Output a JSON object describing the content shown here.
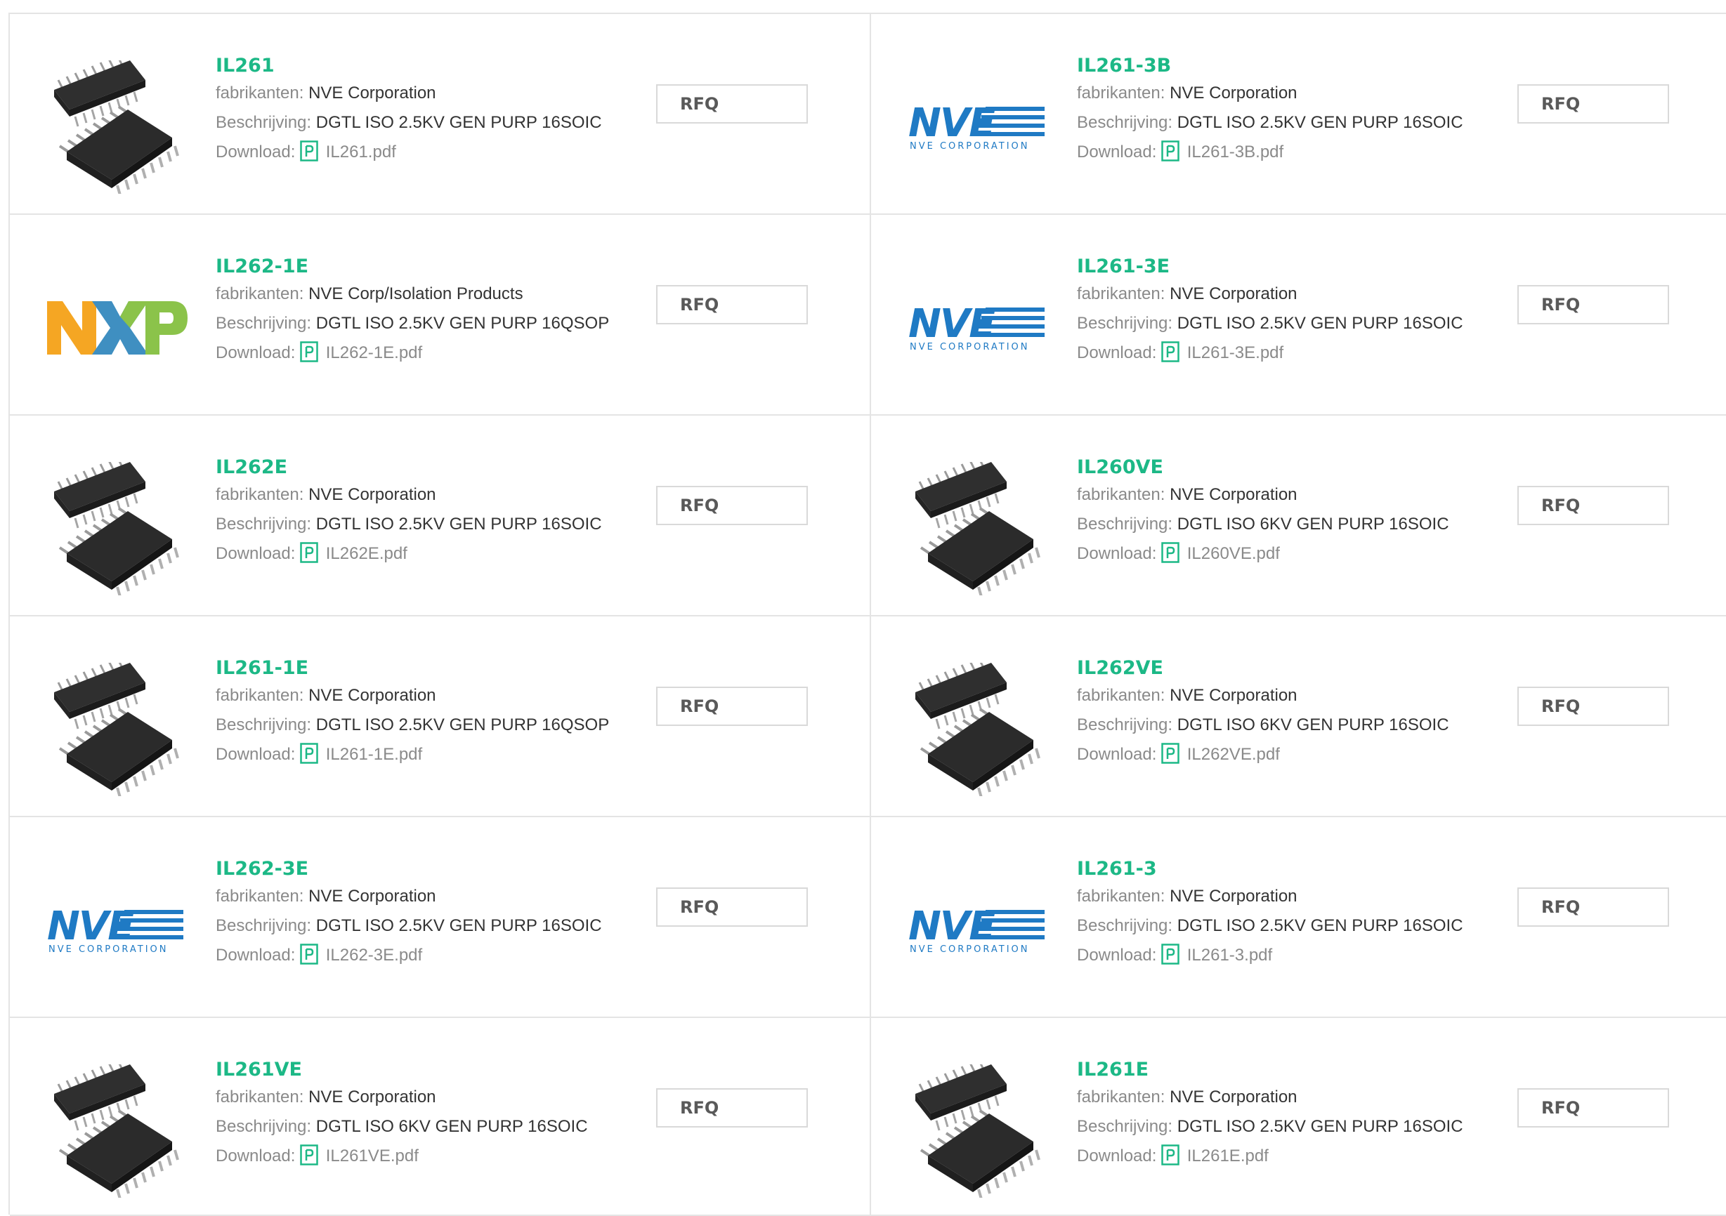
{
  "labels": {
    "manufacturer": "fabrikanten:",
    "description": "Beschrijving:",
    "download": "Download:",
    "rfq": "RFQ"
  },
  "colors": {
    "part_name": "#1cb886",
    "nve_blue": "#1f7ac4",
    "pdf_icon": "#1cb886"
  },
  "products": [
    {
      "name": "IL261",
      "manufacturer": "NVE Corporation",
      "description": "DGTL ISO 2.5KV GEN PURP 16SOIC",
      "file": "IL261.pdf",
      "image": "ic-chip"
    },
    {
      "name": "IL261-3B",
      "manufacturer": "NVE Corporation",
      "description": "DGTL ISO 2.5KV GEN PURP 16SOIC",
      "file": "IL261-3B.pdf",
      "image": "nve-logo",
      "logo_text": "NVE",
      "logo_sub": "NVE CORPORATION"
    },
    {
      "name": "IL262-1E",
      "manufacturer": "NVE Corp/Isolation Products",
      "description": "DGTL ISO 2.5KV GEN PURP 16QSOP",
      "file": "IL262-1E.pdf",
      "image": "nxp-logo"
    },
    {
      "name": "IL261-3E",
      "manufacturer": "NVE Corporation",
      "description": "DGTL ISO 2.5KV GEN PURP 16SOIC",
      "file": "IL261-3E.pdf",
      "image": "nve-logo",
      "logo_text": "NVE",
      "logo_sub": "NVE CORPORATION"
    },
    {
      "name": "IL262E",
      "manufacturer": "NVE Corporation",
      "description": "DGTL ISO 2.5KV GEN PURP 16SOIC",
      "file": "IL262E.pdf",
      "image": "ic-chip"
    },
    {
      "name": "IL260VE",
      "manufacturer": "NVE Corporation",
      "description": "DGTL ISO 6KV GEN PURP 16SOIC",
      "file": "IL260VE.pdf",
      "image": "ic-chip"
    },
    {
      "name": "IL261-1E",
      "manufacturer": "NVE Corporation",
      "description": "DGTL ISO 2.5KV GEN PURP 16QSOP",
      "file": "IL261-1E.pdf",
      "image": "ic-chip"
    },
    {
      "name": "IL262VE",
      "manufacturer": "NVE Corporation",
      "description": "DGTL ISO 6KV GEN PURP 16SOIC",
      "file": "IL262VE.pdf",
      "image": "ic-chip"
    },
    {
      "name": "IL262-3E",
      "manufacturer": "NVE Corporation",
      "description": "DGTL ISO 2.5KV GEN PURP 16SOIC",
      "file": "IL262-3E.pdf",
      "image": "nve-logo",
      "logo_text": "NVE",
      "logo_sub": "NVE CORPORATION"
    },
    {
      "name": "IL261-3",
      "manufacturer": "NVE Corporation",
      "description": "DGTL ISO 2.5KV GEN PURP 16SOIC",
      "file": "IL261-3.pdf",
      "image": "nve-logo",
      "logo_text": "NVE",
      "logo_sub": "NVE CORPORATION"
    },
    {
      "name": "IL261VE",
      "manufacturer": "NVE Corporation",
      "description": "DGTL ISO 6KV GEN PURP 16SOIC",
      "file": "IL261VE.pdf",
      "image": "ic-chip"
    },
    {
      "name": "IL261E",
      "manufacturer": "NVE Corporation",
      "description": "DGTL ISO 2.5KV GEN PURP 16SOIC",
      "file": "IL261E.pdf",
      "image": "ic-chip"
    }
  ]
}
